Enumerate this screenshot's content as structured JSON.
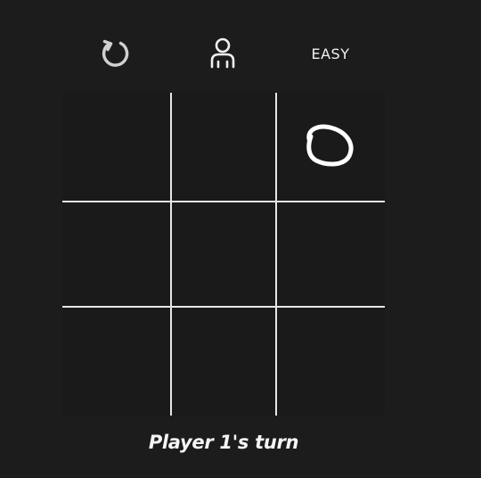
{
  "toolbar": {
    "restart_icon": "restart-icon",
    "player_icon": "single-player-icon",
    "difficulty_label": "EASY"
  },
  "board": {
    "cells": [
      "",
      "",
      "O",
      "",
      "",
      "",
      "",
      "",
      ""
    ]
  },
  "status": {
    "text": "Player 1's turn"
  },
  "colors": {
    "background": "#1c1c1c",
    "board": "#1a1a1a",
    "lines": "#e6e6e6",
    "mark": "#ffffff"
  }
}
